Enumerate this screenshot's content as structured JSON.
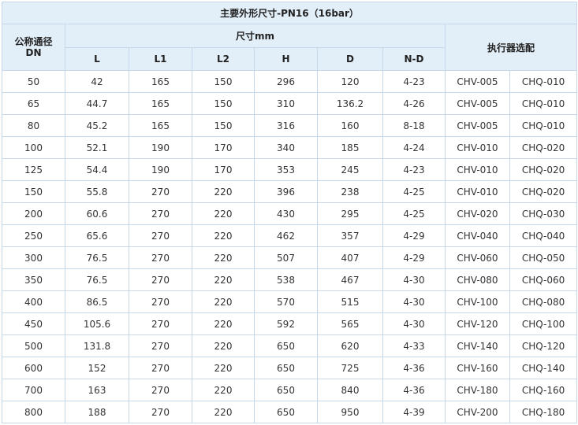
{
  "table": {
    "title": "主要外形尺寸-PN16（16bar）",
    "header": {
      "dn_label_line1": "公称通径",
      "dn_label_line2": "DN",
      "size_group": "尺寸mm",
      "actuator_group": "执行器选配",
      "columns": [
        "L",
        "L1",
        "L2",
        "H",
        "D",
        "N-D"
      ]
    },
    "rows": [
      [
        "50",
        "42",
        "165",
        "150",
        "296",
        "120",
        "4-23",
        "CHV-005",
        "CHQ-010"
      ],
      [
        "65",
        "44.7",
        "165",
        "150",
        "310",
        "136.2",
        "4-26",
        "CHV-005",
        "CHQ-010"
      ],
      [
        "80",
        "45.2",
        "165",
        "150",
        "316",
        "160",
        "8-18",
        "CHV-005",
        "CHQ-010"
      ],
      [
        "100",
        "52.1",
        "190",
        "170",
        "340",
        "185",
        "4-24",
        "CHV-010",
        "CHQ-020"
      ],
      [
        "125",
        "54.4",
        "190",
        "170",
        "353",
        "245",
        "4-23",
        "CHV-010",
        "CHQ-020"
      ],
      [
        "150",
        "55.8",
        "270",
        "220",
        "396",
        "238",
        "4-25",
        "CHV-010",
        "CHQ-020"
      ],
      [
        "200",
        "60.6",
        "270",
        "220",
        "430",
        "295",
        "4-25",
        "CHV-020",
        "CHQ-030"
      ],
      [
        "250",
        "65.6",
        "270",
        "220",
        "462",
        "357",
        "4-29",
        "CHV-040",
        "CHQ-040"
      ],
      [
        "300",
        "76.5",
        "270",
        "220",
        "507",
        "407",
        "4-29",
        "CHV-060",
        "CHQ-050"
      ],
      [
        "350",
        "76.5",
        "270",
        "220",
        "538",
        "467",
        "4-30",
        "CHV-080",
        "CHQ-060"
      ],
      [
        "400",
        "86.5",
        "270",
        "220",
        "570",
        "515",
        "4-30",
        "CHV-100",
        "CHQ-080"
      ],
      [
        "450",
        "105.6",
        "270",
        "220",
        "592",
        "565",
        "4-30",
        "CHV-120",
        "CHQ-100"
      ],
      [
        "500",
        "131.8",
        "270",
        "220",
        "650",
        "620",
        "4-33",
        "CHV-140",
        "CHQ-120"
      ],
      [
        "600",
        "152",
        "270",
        "220",
        "650",
        "725",
        "4-36",
        "CHV-160",
        "CHQ-140"
      ],
      [
        "700",
        "163",
        "270",
        "220",
        "650",
        "840",
        "4-36",
        "CHV-180",
        "CHQ-160"
      ],
      [
        "800",
        "188",
        "270",
        "220",
        "650",
        "950",
        "4-39",
        "CHV-200",
        "CHQ-180"
      ]
    ]
  }
}
